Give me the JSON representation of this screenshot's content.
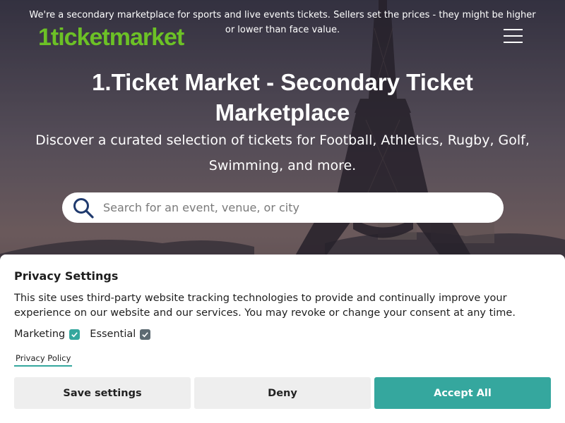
{
  "header": {
    "notice": "We're a secondary marketplace for sports and live events tickets. Sellers set the prices - they might be higher or lower than face value.",
    "logo_text": "1ticketmarket",
    "logo_color": "#6cc126",
    "menu_icon": "hamburger-menu-icon"
  },
  "hero": {
    "title": "1.Ticket Market - Secondary Ticket Marketplace",
    "subtitle": "Discover a curated selection of tickets for Football, Athletics, Rugby, Golf, Swimming, and more.",
    "background": "eiffel-tower-photo"
  },
  "search": {
    "placeholder": "Search for an event, venue, or city",
    "value": "",
    "icon": "search-icon",
    "icon_color": "#1f3a6e"
  },
  "privacy": {
    "title": "Privacy Settings",
    "description": "This site uses third-party website tracking technologies to provide and continually improve your experience on our website and our services. You may revoke or change your consent at any time.",
    "options": [
      {
        "label": "Marketing",
        "checked": true
      },
      {
        "label": "Essential",
        "checked": true
      }
    ],
    "policy_link": "Privacy Policy",
    "buttons": {
      "save": "Save settings",
      "deny": "Deny",
      "accept": "Accept All"
    },
    "accent_color": "#35a79e"
  }
}
